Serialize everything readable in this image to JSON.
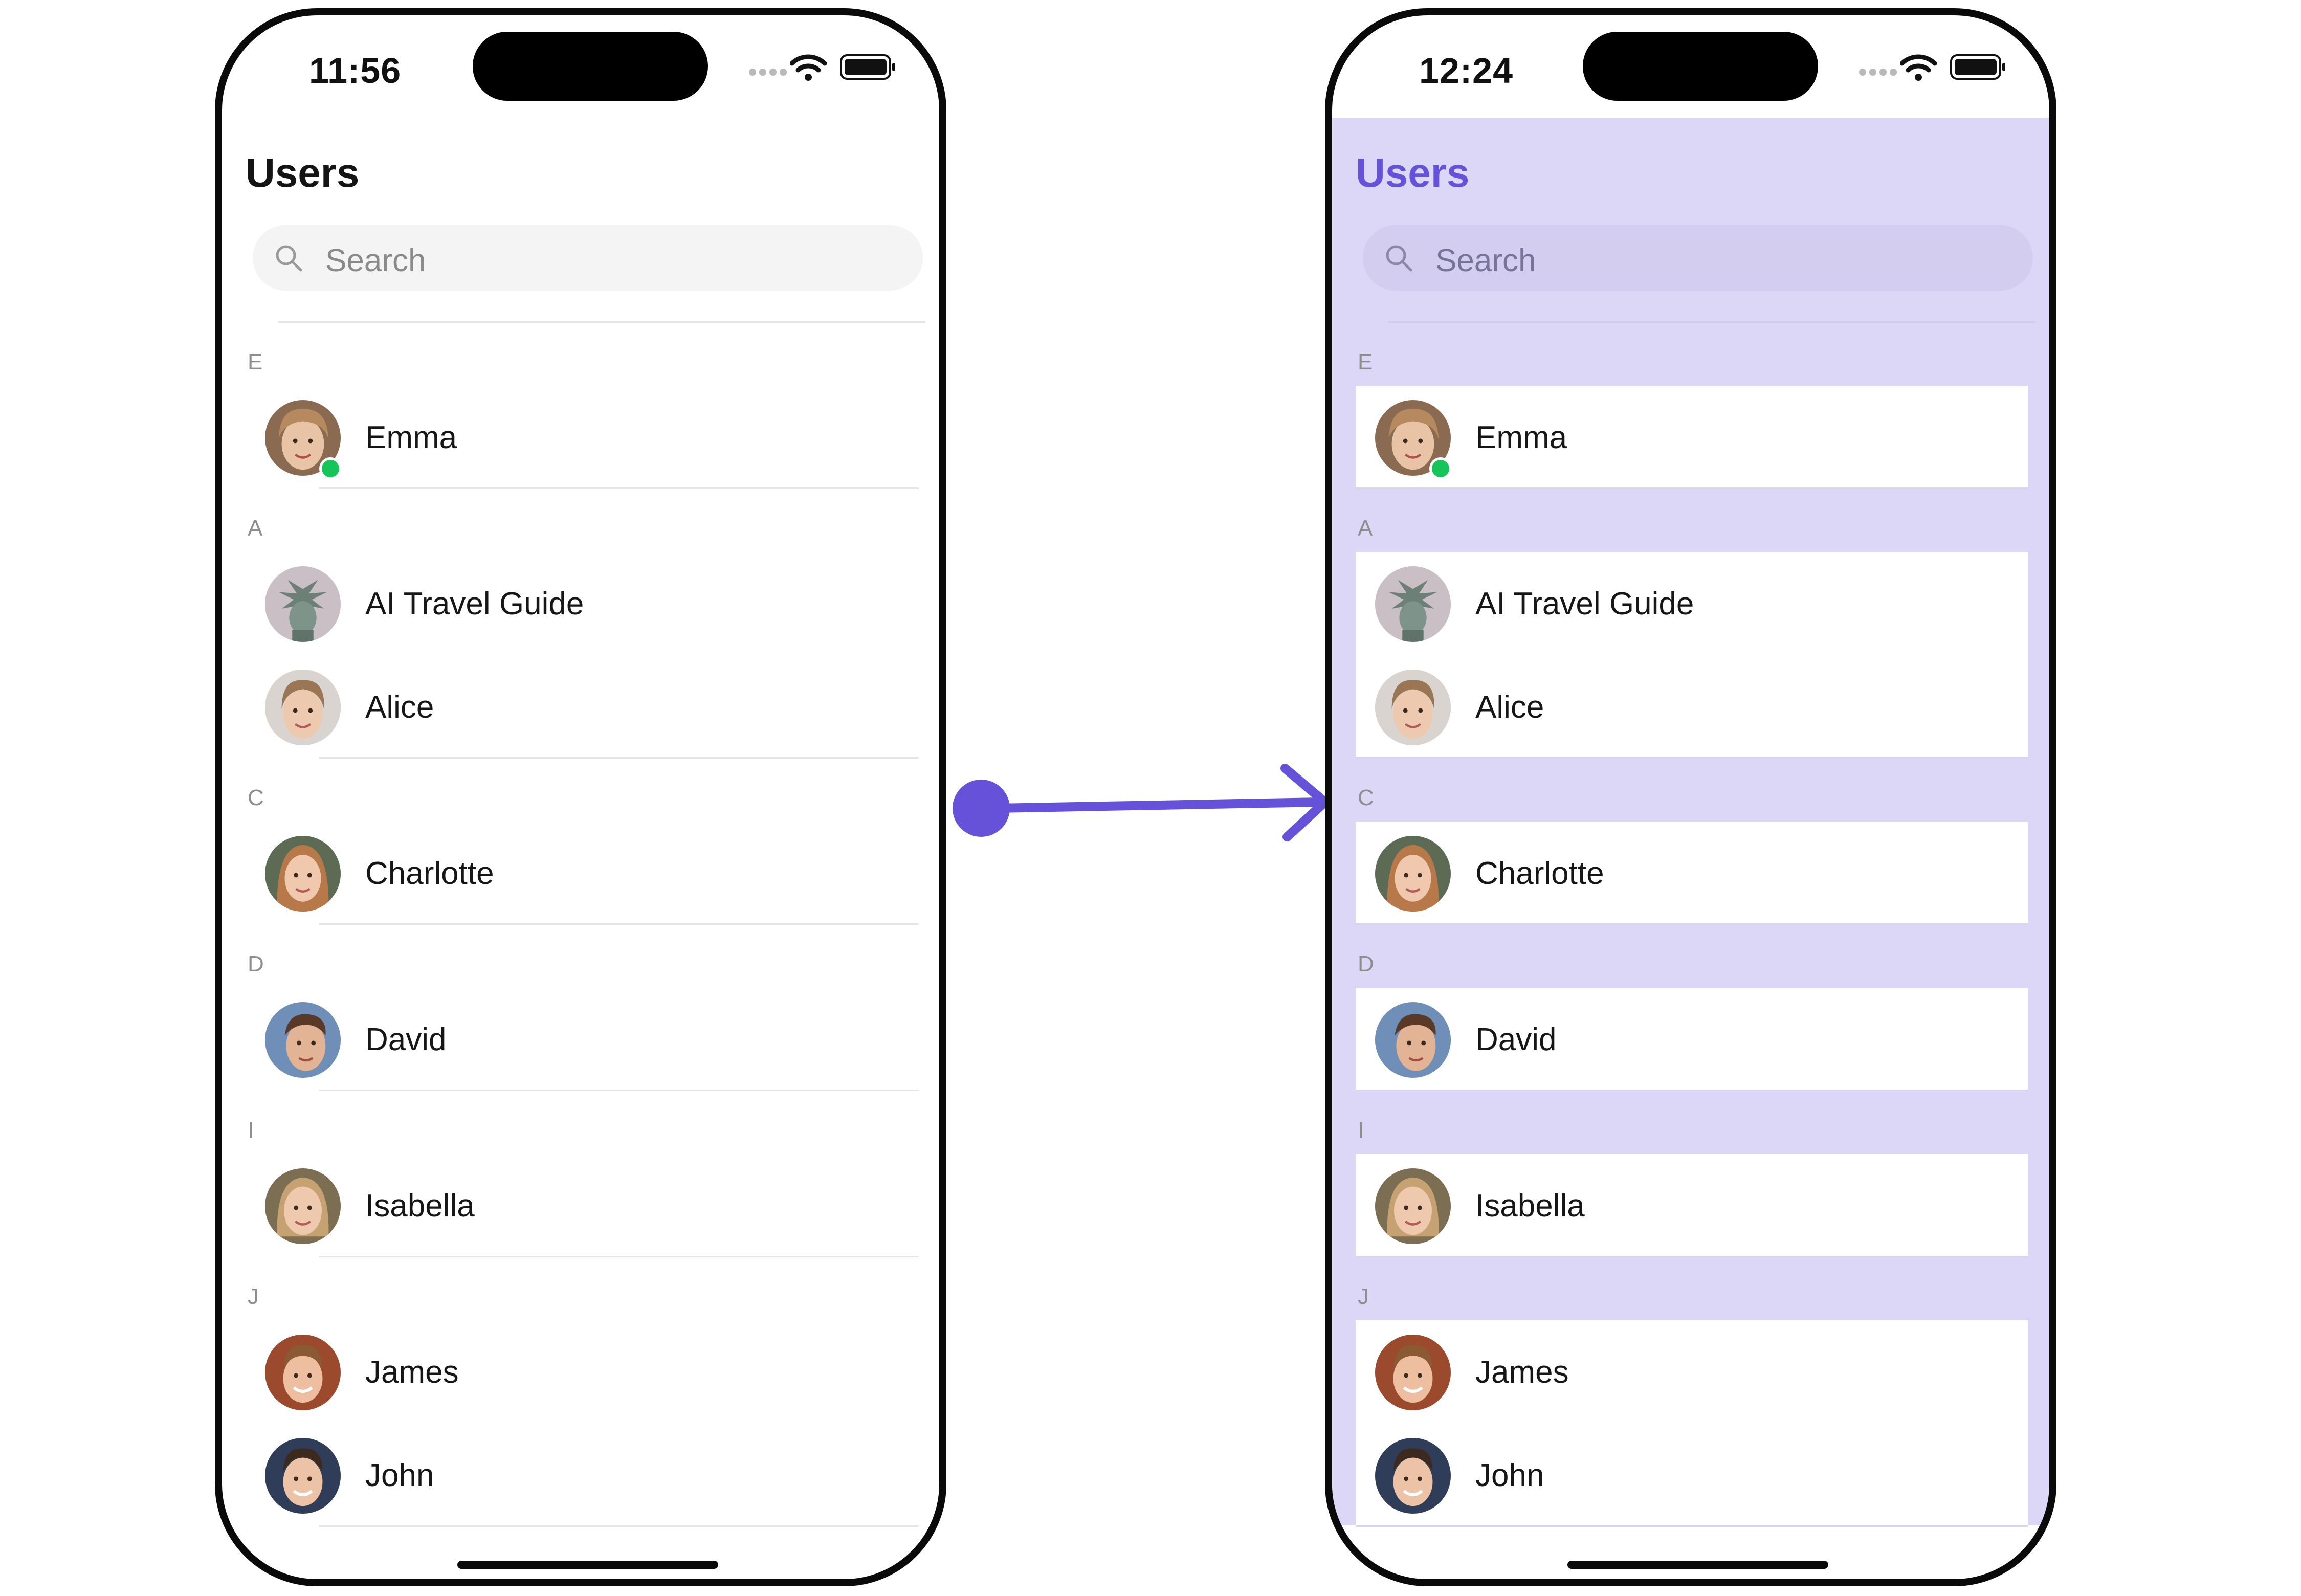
{
  "left_phone": {
    "status": {
      "time": "11:56"
    },
    "title": "Users",
    "search": {
      "placeholder": "Search"
    }
  },
  "right_phone": {
    "status": {
      "time": "12:24"
    },
    "title": "Users",
    "search": {
      "placeholder": "Search"
    }
  },
  "colors": {
    "accent": "#6652d9",
    "theme_background": "#dcd7f6",
    "online": "#16c55a",
    "arrow": "#6652d9"
  },
  "sections": [
    {
      "letter": "E",
      "items": [
        {
          "name": "Emma",
          "online": true,
          "avatar": "emma-avatar"
        }
      ]
    },
    {
      "letter": "A",
      "items": [
        {
          "name": "AI Travel Guide",
          "online": false,
          "avatar": "statue-of-liberty-avatar"
        },
        {
          "name": "Alice",
          "online": false,
          "avatar": "alice-avatar"
        }
      ]
    },
    {
      "letter": "C",
      "items": [
        {
          "name": "Charlotte",
          "online": false,
          "avatar": "charlotte-avatar"
        }
      ]
    },
    {
      "letter": "D",
      "items": [
        {
          "name": "David",
          "online": false,
          "avatar": "david-avatar"
        }
      ]
    },
    {
      "letter": "I",
      "items": [
        {
          "name": "Isabella",
          "online": false,
          "avatar": "isabella-avatar"
        }
      ]
    },
    {
      "letter": "J",
      "items": [
        {
          "name": "James",
          "online": false,
          "avatar": "james-avatar"
        },
        {
          "name": "John",
          "online": false,
          "avatar": "john-avatar"
        }
      ]
    }
  ],
  "icons": {
    "search": "search-icon",
    "wifi": "wifi-icon",
    "battery": "battery-icon",
    "arrow": "right-arrow-icon"
  }
}
